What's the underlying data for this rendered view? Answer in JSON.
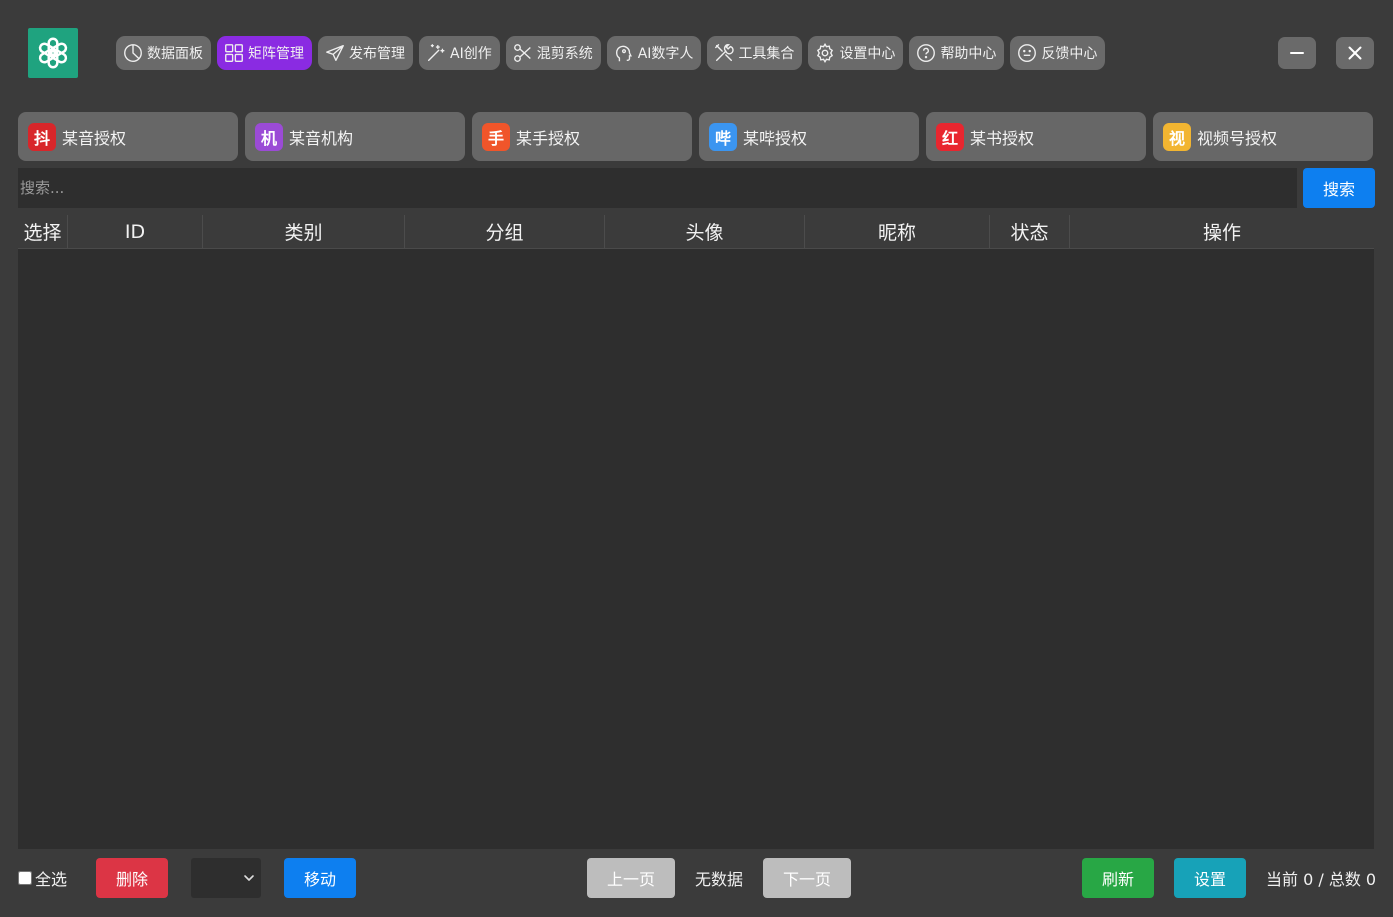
{
  "colors": {
    "accent_purple": "#8a2be2",
    "primary_blue": "#0d7ff0",
    "danger_red": "#dc3545",
    "success_green": "#28a745",
    "info_teal": "#17a2b8",
    "logo_green": "#1fa37f"
  },
  "logo": {
    "icon": "openai-knot-icon"
  },
  "nav": [
    {
      "label": "数据面板",
      "icon": "pie-chart-icon"
    },
    {
      "label": "矩阵管理",
      "icon": "grid-icon",
      "active": true
    },
    {
      "label": "发布管理",
      "icon": "send-icon"
    },
    {
      "label": "AI创作",
      "icon": "magic-wand-icon"
    },
    {
      "label": "混剪系统",
      "icon": "scissors-icon"
    },
    {
      "label": "AI数字人",
      "icon": "head-icon"
    },
    {
      "label": "工具集合",
      "icon": "tools-icon"
    },
    {
      "label": "设置中心",
      "icon": "gear-icon"
    },
    {
      "label": "帮助中心",
      "icon": "question-icon"
    },
    {
      "label": "反馈中心",
      "icon": "smile-icon"
    }
  ],
  "window": {
    "minimize_icon": "minimize-icon",
    "close_icon": "close-icon"
  },
  "platforms": [
    {
      "badge": "抖",
      "label": "某音授权",
      "color": "#d8262a"
    },
    {
      "badge": "机",
      "label": "某音机构",
      "color": "#9b4bd6"
    },
    {
      "badge": "手",
      "label": "某手授权",
      "color": "#f0552a"
    },
    {
      "badge": "哔",
      "label": "某哔授权",
      "color": "#3b95f0"
    },
    {
      "badge": "红",
      "label": "某书授权",
      "color": "#e8262f"
    },
    {
      "badge": "视",
      "label": "视频号授权",
      "color": "#f2b531"
    }
  ],
  "search": {
    "placeholder": "搜索...",
    "value": "",
    "button_label": "搜索"
  },
  "table": {
    "columns": [
      "选择",
      "ID",
      "类别",
      "分组",
      "头像",
      "昵称",
      "状态",
      "操作"
    ],
    "rows": []
  },
  "footer": {
    "select_all_label": "全选",
    "delete_label": "删除",
    "dropdown_value": "",
    "move_label": "移动",
    "prev_label": "上一页",
    "page_status": "无数据",
    "next_label": "下一页",
    "refresh_label": "刷新",
    "settings_label": "设置",
    "count_text": "当前 0 / 总数 0"
  }
}
